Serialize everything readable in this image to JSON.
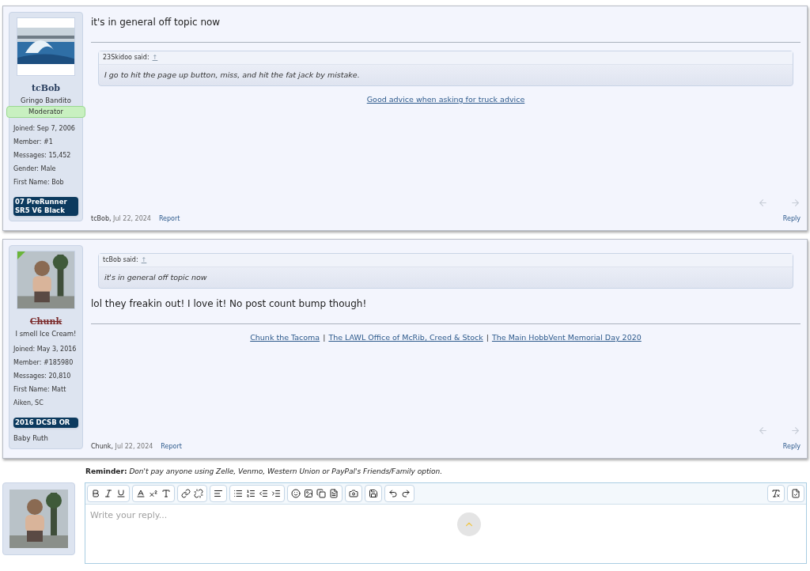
{
  "posts": [
    {
      "user": {
        "name": "tcBob",
        "struck": false,
        "title": "Gringo Bandito",
        "role": "Moderator",
        "new_corner": false,
        "info": [
          {
            "label": "Joined:",
            "value": "Sep 7, 2006"
          },
          {
            "label": "Member:",
            "value": "#1"
          },
          {
            "label": "Messages:",
            "value": "15,452"
          },
          {
            "label": "Gender:",
            "value": "Male"
          },
          {
            "label": "First Name:",
            "value": "Bob"
          }
        ],
        "vehicle": "07 PreRunner SR5 V6 Black"
      },
      "blocks": [
        {
          "kind": "text",
          "text": "it's in general off topic now"
        },
        {
          "kind": "rule"
        },
        {
          "kind": "quote",
          "author": "23Skidoo said:",
          "arrow": "↑",
          "text": "I go to hit the page up button, miss, and hit the fat jack by mistake."
        },
        {
          "kind": "signature",
          "links": [
            "Good advice when asking for truck advice"
          ]
        }
      ],
      "footer": {
        "author": "tcBob,",
        "date": "Jul 22, 2024",
        "report": "Report",
        "reply": "Reply"
      }
    },
    {
      "user": {
        "name": "Chunk",
        "struck": true,
        "title": "I smell Ice Cream!",
        "new_corner": true,
        "info": [
          {
            "label": "Joined:",
            "value": "May 3, 2016"
          },
          {
            "label": "Member:",
            "value": "#185980"
          },
          {
            "label": "Messages:",
            "value": "20,810"
          },
          {
            "label": "First Name:",
            "value": "Matt"
          },
          {
            "value": "Aiken, SC"
          }
        ],
        "vehicle": "2016 DCSB OR",
        "after": [
          "Baby Ruth"
        ]
      },
      "blocks": [
        {
          "kind": "quote",
          "author": "tcBob said:",
          "arrow": "↑",
          "text": "it's in general off topic now"
        },
        {
          "kind": "text",
          "text": "lol they freakin out! I love it! No post count bump though!"
        },
        {
          "kind": "rule"
        },
        {
          "kind": "signature",
          "links": [
            "Chunk the Tacoma",
            "The LAWL Office of McRib, Creed & Stock",
            "The Main HobbVent Memorial Day 2020"
          ],
          "separator": "|"
        }
      ],
      "footer": {
        "author": "Chunk,",
        "date": "Jul 22, 2024",
        "report": "Report",
        "reply": "Reply"
      }
    }
  ],
  "reminder": "**Reminder:** *Don't pay anyone using Zelle, Venmo, Western Union or PayPal's Friends/Family option.*",
  "editor": {
    "placeholder": "Write your reply..."
  }
}
